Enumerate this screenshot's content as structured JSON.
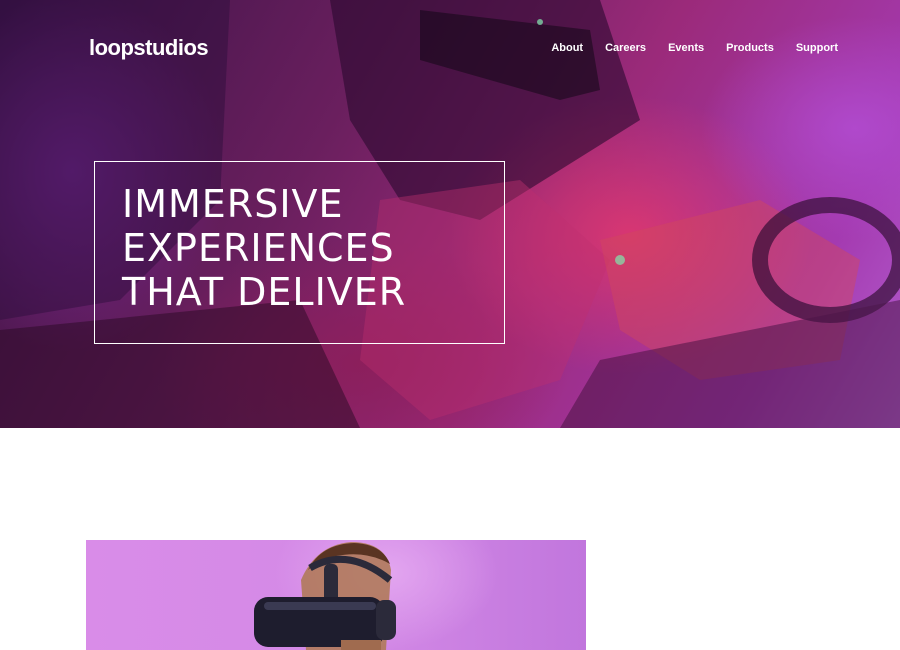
{
  "header": {
    "logo": "loopstudios",
    "nav": [
      {
        "label": "About"
      },
      {
        "label": "Careers"
      },
      {
        "label": "Events"
      },
      {
        "label": "Products"
      },
      {
        "label": "Support"
      }
    ]
  },
  "hero": {
    "title": "IMMERSIVE\nEXPERIENCES\nTHAT DELIVER"
  },
  "colors": {
    "hero_magenta": "#a43ab0",
    "hero_dark": "#3a1347",
    "hero_red": "#e2386e",
    "box_border": "#ffffff",
    "content_image_pink": "#d98ce8"
  },
  "icons": {
    "hero_scene": "vr-gamer-photo",
    "content_scene": "vr-headset-photo"
  }
}
